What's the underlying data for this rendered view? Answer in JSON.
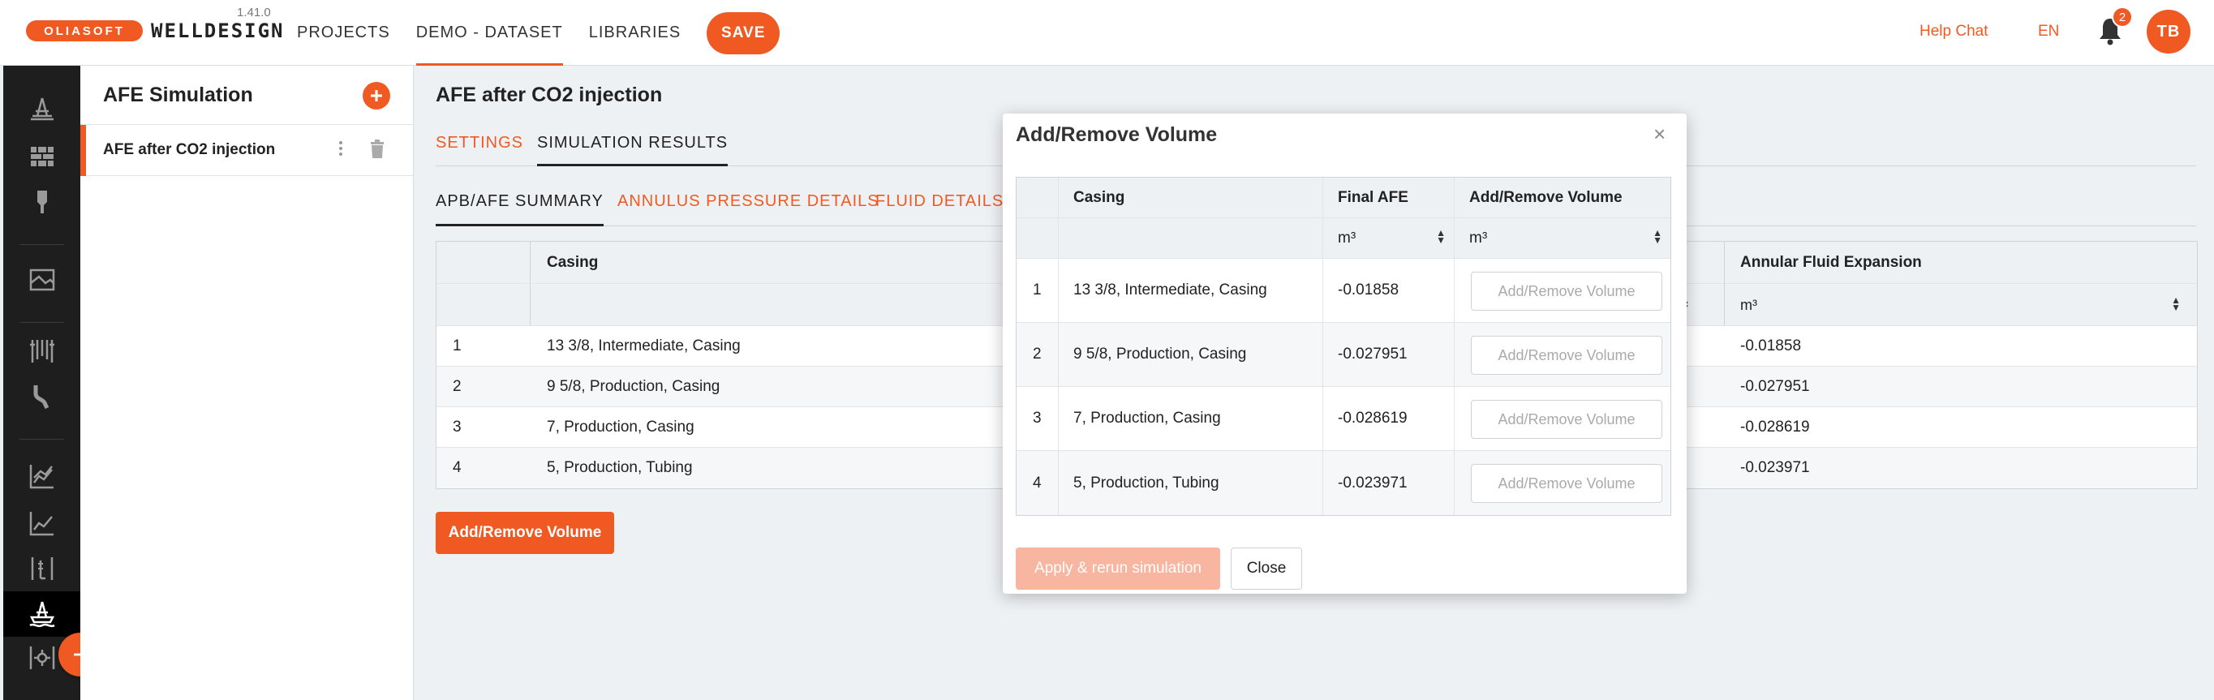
{
  "app": {
    "logo_text": "OLIASOFT",
    "brand": "WELLDESIGN",
    "version": "1.41.0"
  },
  "nav": {
    "items": [
      {
        "label": "PROJECTS",
        "active": false
      },
      {
        "label": "DEMO - DATASET",
        "active": true
      },
      {
        "label": "LIBRARIES",
        "active": false
      }
    ],
    "save_label": "SAVE",
    "help_chat": "Help Chat",
    "language": "EN",
    "notification_count": "2",
    "user_initials": "TB"
  },
  "rail": {
    "icons": [
      "rig-icon",
      "wall-icon",
      "tower-icon",
      "map-layers-icon",
      "casing-strings-icon",
      "trajectory-icon",
      "chart-area-icon",
      "chart-line-icon",
      "well-schematic-icon",
      "offshore-rig-icon",
      "settings-well-icon"
    ],
    "active_icon": "offshore-rig-icon"
  },
  "simulations": {
    "title": "AFE Simulation",
    "items": [
      {
        "label": "AFE after CO2 injection",
        "active": true
      }
    ]
  },
  "main": {
    "title": "AFE after CO2 injection",
    "tabs": [
      {
        "label": "SETTINGS",
        "active": false
      },
      {
        "label": "SIMULATION RESULTS",
        "active": true
      }
    ],
    "subtabs": [
      {
        "label": "APB/AFE SUMMARY",
        "active": true
      },
      {
        "label": "ANNULUS PRESSURE DETAILS",
        "active": false
      },
      {
        "label": "FLUID DETAILS",
        "active": false
      }
    ],
    "table": {
      "headers": [
        "",
        "Casing",
        "Annular Fluid Expansion"
      ],
      "unit": "m³",
      "rows": [
        {
          "index": "1",
          "casing": "13 3/8, Intermediate, Casing",
          "afe": "-0.01858"
        },
        {
          "index": "2",
          "casing": "9 5/8, Production, Casing",
          "afe": "-0.027951"
        },
        {
          "index": "3",
          "casing": "7, Production, Casing",
          "afe": "-0.028619"
        },
        {
          "index": "4",
          "casing": "5, Production, Tubing",
          "afe": "-0.023971"
        }
      ]
    },
    "add_remove_button": "Add/Remove Volume"
  },
  "modal": {
    "title": "Add/Remove Volume",
    "close_icon": "×",
    "headers": [
      "",
      "Casing",
      "Final AFE",
      "Add/Remove Volume"
    ],
    "units": {
      "final_afe": "m³",
      "add_remove": "m³"
    },
    "input_placeholder": "Add/Remove Volume",
    "rows": [
      {
        "index": "1",
        "casing": "13 3/8, Intermediate, Casing",
        "final_afe": "-0.01858"
      },
      {
        "index": "2",
        "casing": "9 5/8, Production, Casing",
        "final_afe": "-0.027951"
      },
      {
        "index": "3",
        "casing": "7, Production, Casing",
        "final_afe": "-0.028619"
      },
      {
        "index": "4",
        "casing": "5, Production, Tubing",
        "final_afe": "-0.023971"
      }
    ],
    "apply_label": "Apply & rerun simulation",
    "close_label": "Close"
  }
}
